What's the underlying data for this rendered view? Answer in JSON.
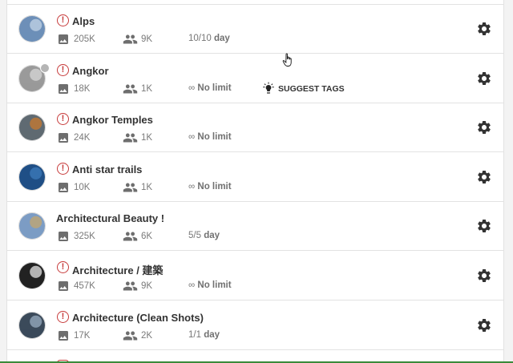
{
  "groups": [
    {
      "name": "Alps",
      "warning": true,
      "photos": "205K",
      "members": "9K",
      "limit_count": "10/10",
      "limit_unit": "day",
      "limit_type": "ratio",
      "avatar_color": "#6d8fb8",
      "avatar_accent": "#c9d8ea"
    },
    {
      "name": "Angkor",
      "warning": true,
      "photos": "18K",
      "members": "1K",
      "limit_symbol": "∞",
      "limit_text": "No limit",
      "limit_type": "none",
      "suggest_tags": "SUGGEST TAGS",
      "has_badge": true,
      "avatar_color": "#9a9a9a",
      "avatar_accent": "#dcdcdc"
    },
    {
      "name": "Angkor Temples",
      "warning": true,
      "photos": "24K",
      "members": "1K",
      "limit_symbol": "∞",
      "limit_text": "No limit",
      "limit_type": "none",
      "avatar_color": "#5f6a72",
      "avatar_accent": "#d07a2a"
    },
    {
      "name": "Anti star trails",
      "warning": true,
      "photos": "10K",
      "members": "1K",
      "limit_symbol": "∞",
      "limit_text": "No limit",
      "limit_type": "none",
      "avatar_color": "#1f4f86",
      "avatar_accent": "#3f7fbf"
    },
    {
      "name": "Architectural Beauty !",
      "warning": false,
      "photos": "325K",
      "members": "6K",
      "limit_count": "5/5",
      "limit_unit": "day",
      "limit_type": "ratio",
      "avatar_color": "#7c9cc4",
      "avatar_accent": "#c9a86a"
    },
    {
      "name": "Architecture / 建築",
      "warning": true,
      "photos": "457K",
      "members": "9K",
      "limit_symbol": "∞",
      "limit_text": "No limit",
      "limit_type": "none",
      "avatar_color": "#222222",
      "avatar_accent": "#f2f2f2"
    },
    {
      "name": "Architecture (Clean Shots)",
      "warning": true,
      "photos": "17K",
      "members": "2K",
      "limit_count": "1/1",
      "limit_unit": "day",
      "limit_type": "ratio",
      "avatar_color": "#3b4a5a",
      "avatar_accent": "#9fb3c8"
    }
  ],
  "icons": {
    "warning": "warning-icon",
    "photos": "image-icon",
    "members": "people-icon",
    "settings": "gear-icon",
    "suggest": "lightbulb-icon",
    "cursor": "hand-pointer-icon"
  },
  "colors": {
    "warning": "#c73b3b",
    "text": "#333333",
    "muted": "#7a7a7a",
    "icon": "#6e6e6e",
    "divider": "#e2e2e2",
    "accent_bottom": "#3a8a3a"
  }
}
